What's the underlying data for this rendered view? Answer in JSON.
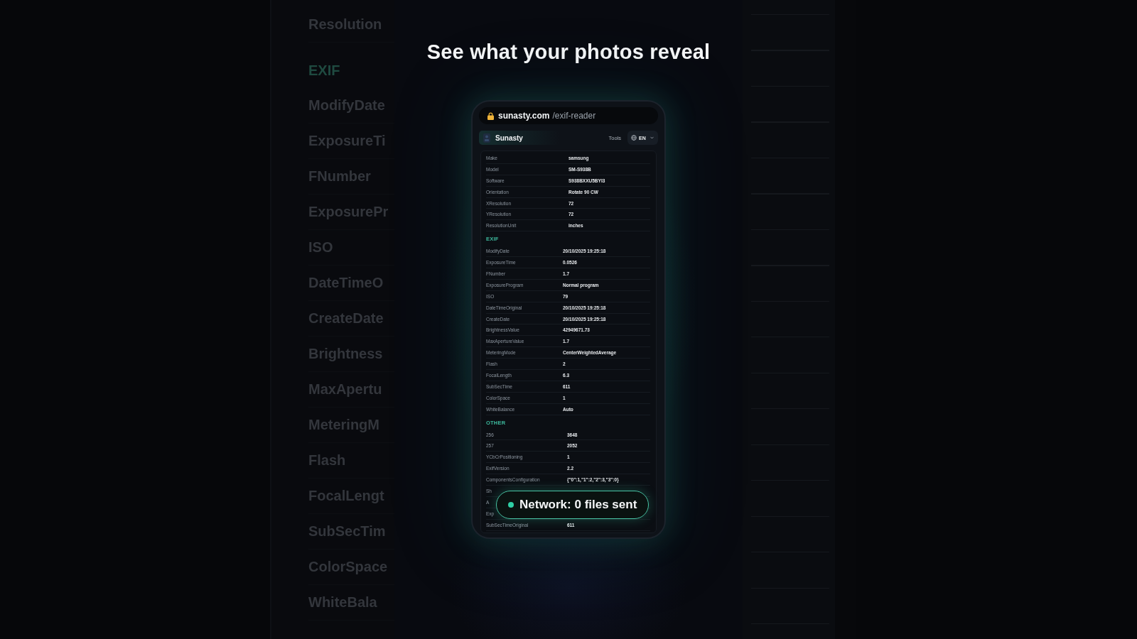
{
  "background_column": {
    "rows": [
      {
        "kind": "label",
        "text": "Resolution"
      },
      {
        "kind": "heading",
        "text": "EXIF"
      },
      {
        "kind": "label",
        "text": "ModifyDate"
      },
      {
        "kind": "label",
        "text": "ExposureTi"
      },
      {
        "kind": "label",
        "text": "FNumber"
      },
      {
        "kind": "label",
        "text": "ExposurePr"
      },
      {
        "kind": "label",
        "text": "ISO"
      },
      {
        "kind": "label",
        "text": "DateTimeO"
      },
      {
        "kind": "label",
        "text": "CreateDate"
      },
      {
        "kind": "label",
        "text": "Brightness"
      },
      {
        "kind": "label",
        "text": "MaxApertu"
      },
      {
        "kind": "label",
        "text": "MeteringM"
      },
      {
        "kind": "label",
        "text": "Flash"
      },
      {
        "kind": "label",
        "text": "FocalLengt"
      },
      {
        "kind": "label",
        "text": "SubSecTim"
      },
      {
        "kind": "label",
        "text": "ColorSpace"
      },
      {
        "kind": "label",
        "text": "WhiteBala"
      }
    ]
  },
  "title": "See what your photos reveal",
  "address_bar": {
    "domain": "sunasty.com",
    "path": "/exif-reader"
  },
  "app_header": {
    "brand": "Sunasty",
    "nav_link": "Tools",
    "language": "EN"
  },
  "metadata_table": {
    "sections": [
      {
        "rows": [
          {
            "label": "Make",
            "value": "samsung"
          },
          {
            "label": "Model",
            "value": "SM-S938B"
          },
          {
            "label": "Software",
            "value": "S938BXXU5BYI3"
          },
          {
            "label": "Orientation",
            "value": "Rotate 90 CW"
          },
          {
            "label": "XResolution",
            "value": "72"
          },
          {
            "label": "YResolution",
            "value": "72"
          },
          {
            "label": "ResolutionUnit",
            "value": "inches"
          }
        ]
      },
      {
        "heading": "EXIF",
        "rows": [
          {
            "label": "ModifyDate",
            "value": "20/10/2025 19:25:18"
          },
          {
            "label": "ExposureTime",
            "value": "0.0526"
          },
          {
            "label": "FNumber",
            "value": "1.7"
          },
          {
            "label": "ExposureProgram",
            "value": "Normal program"
          },
          {
            "label": "ISO",
            "value": "79"
          },
          {
            "label": "DateTimeOriginal",
            "value": "20/10/2025 19:25:18"
          },
          {
            "label": "CreateDate",
            "value": "20/10/2025 19:25:18"
          },
          {
            "label": "BrightnessValue",
            "value": "42949671.73"
          },
          {
            "label": "MaxApertureValue",
            "value": "1.7"
          },
          {
            "label": "MeteringMode",
            "value": "CenterWeightedAverage"
          },
          {
            "label": "Flash",
            "value": "2"
          },
          {
            "label": "FocalLength",
            "value": "6.3"
          },
          {
            "label": "SubSecTime",
            "value": "611"
          },
          {
            "label": "ColorSpace",
            "value": "1"
          },
          {
            "label": "WhiteBalance",
            "value": "Auto"
          }
        ]
      },
      {
        "heading": "OTHER",
        "rows": [
          {
            "label": "256",
            "value": "3648"
          },
          {
            "label": "257",
            "value": "2052"
          },
          {
            "label": "YCbCrPositioning",
            "value": "1"
          },
          {
            "label": "ExifVersion",
            "value": "2.2"
          },
          {
            "label": "ComponentsConfiguration",
            "value": "{\"0\":1,\"1\":2,\"2\":3,\"3\":0}"
          },
          {
            "label": "Sh"
          },
          {
            "label": "A"
          },
          {
            "label": "Exp"
          },
          {
            "label": "SubSecTimeOriginal",
            "value": "611"
          }
        ]
      }
    ]
  },
  "network_toast": {
    "text": "Network: 0 files sent"
  }
}
